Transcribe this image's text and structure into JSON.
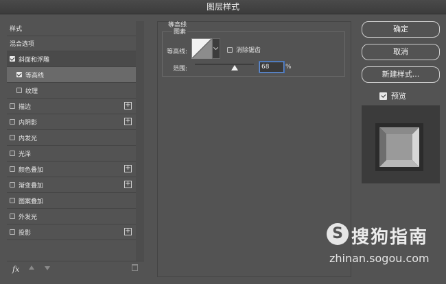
{
  "window": {
    "title": "图层样式"
  },
  "styles_panel": {
    "items": [
      {
        "label": "样式",
        "kind": "header"
      },
      {
        "label": "混合选项",
        "kind": "header"
      },
      {
        "label": "斜面和浮雕",
        "checked": true,
        "state": "selected-parent"
      },
      {
        "label": "等高线",
        "checked": true,
        "indent": true,
        "state": "selected"
      },
      {
        "label": "纹理",
        "checked": false,
        "indent": true
      },
      {
        "label": "描边",
        "checked": false,
        "plus": true
      },
      {
        "label": "内阴影",
        "checked": false,
        "plus": true
      },
      {
        "label": "内发光",
        "checked": false
      },
      {
        "label": "光泽",
        "checked": false
      },
      {
        "label": "颜色叠加",
        "checked": false,
        "plus": true
      },
      {
        "label": "渐变叠加",
        "checked": false,
        "plus": true
      },
      {
        "label": "图案叠加",
        "checked": false
      },
      {
        "label": "外发光",
        "checked": false
      },
      {
        "label": "投影",
        "checked": false,
        "plus": true
      }
    ],
    "footer": {
      "fx_label": "fx"
    }
  },
  "contour_settings": {
    "section_title": "等高线",
    "group_title": "图素",
    "contour_label": "等高线:",
    "anti_alias_label": "消除锯齿",
    "anti_alias_checked": false,
    "range_label": "范围:",
    "range_value": "68",
    "range_unit": "%",
    "range_fraction": 0.68
  },
  "buttons": {
    "ok": "确定",
    "cancel": "取消",
    "new_style": "新建样式...",
    "preview_label": "预览",
    "preview_checked": true
  },
  "watermark": {
    "logo_letter": "S",
    "brand": "搜狗指南",
    "url": "zhinan.sogou.com"
  }
}
